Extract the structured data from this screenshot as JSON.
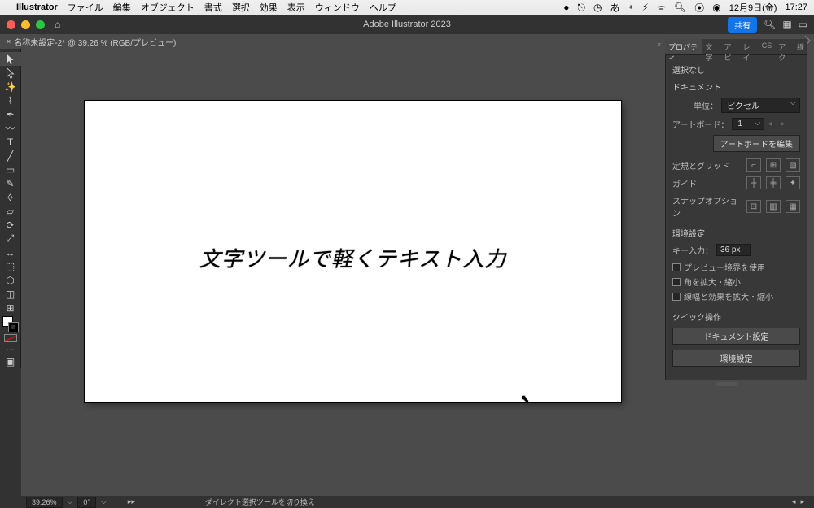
{
  "menubar": {
    "app_name": "Illustrator",
    "items": [
      "ファイル",
      "編集",
      "オブジェクト",
      "書式",
      "選択",
      "効果",
      "表示",
      "ウィンドウ",
      "ヘルプ"
    ],
    "date": "12月9日(金)",
    "time": "17:27"
  },
  "titlebar": {
    "title": "Adobe Illustrator 2023",
    "share": "共有"
  },
  "doc_tab": {
    "label": "名称未設定-2* @ 39.26 % (RGB/プレビュー)"
  },
  "canvas": {
    "sample_text": "文字ツールで軽くテキスト入力"
  },
  "status": {
    "zoom": "39.26%",
    "rot": "0°",
    "hint": "ダイレクト選択ツールを切り換え"
  },
  "panel": {
    "tabs": [
      "プロパティ",
      "文字",
      "アピ",
      "レイ",
      "CS",
      "アク",
      "線"
    ],
    "no_sel": "選択なし",
    "doc_head": "ドキュメント",
    "unit_lbl": "単位：",
    "unit_val": "ピクセル",
    "artboard_lbl": "アートボード：",
    "artboard_val": "1",
    "edit_ab": "アートボードを編集",
    "ruler_grid": "定規とグリッド",
    "guide": "ガイド",
    "snap": "スナップオプション",
    "prefs_head": "環境設定",
    "key_in_lbl": "キー入力：",
    "key_in_val": "36 px",
    "chk1": "プレビュー境界を使用",
    "chk2": "角を拡大・縮小",
    "chk3": "線幅と効果を拡大・縮小",
    "quick_head": "クイック操作",
    "btn_doc": "ドキュメント設定",
    "btn_pref": "環境設定"
  }
}
